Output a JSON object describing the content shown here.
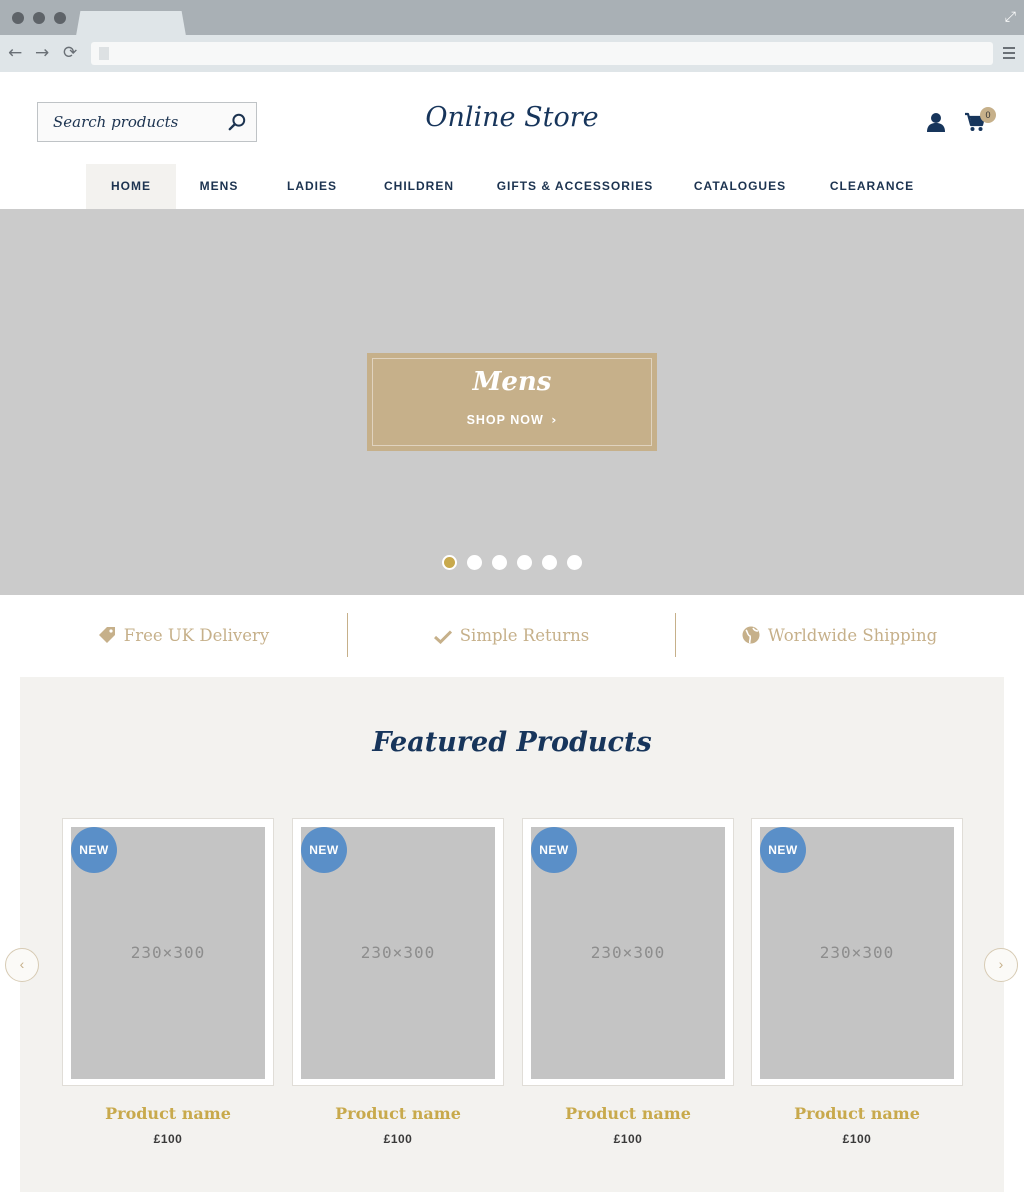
{
  "browser": {
    "window_controls": [
      "close-dot",
      "minimize-dot",
      "maximize-dot"
    ],
    "back_icon": "arrow-left-icon",
    "forward_icon": "arrow-right-icon",
    "reload_icon": "reload-icon",
    "menu_icon": "hamburger-menu-icon"
  },
  "header": {
    "search": {
      "placeholder": "Search products",
      "icon": "search-icon"
    },
    "logo": "Online Store",
    "account_icon": "user-icon",
    "cart": {
      "icon": "cart-icon",
      "count": "0"
    }
  },
  "nav": {
    "items": [
      {
        "label": "HOME",
        "active": true
      },
      {
        "label": "MENS"
      },
      {
        "label": "LADIES"
      },
      {
        "label": "CHILDREN"
      },
      {
        "label": "GIFTS & ACCESSORIES"
      },
      {
        "label": "CATALOGUES"
      },
      {
        "label": "CLEARANCE"
      }
    ]
  },
  "hero": {
    "title": "Mens",
    "cta": "SHOP NOW",
    "slide_count": 6,
    "active_slide": 1
  },
  "features": [
    {
      "label": "Free UK Delivery",
      "icon": "tag-icon"
    },
    {
      "label": "Simple Returns",
      "icon": "checkmark-icon"
    },
    {
      "label": "Worldwide Shipping",
      "icon": "globe-icon"
    }
  ],
  "featured": {
    "title": "Featured Products",
    "prev_icon": "chevron-left-icon",
    "next_icon": "chevron-right-icon",
    "products": [
      {
        "badge": "NEW",
        "image": "230×300",
        "name": "Product name",
        "price": "£100"
      },
      {
        "badge": "NEW",
        "image": "230×300",
        "name": "Product name",
        "price": "£100"
      },
      {
        "badge": "NEW",
        "image": "230×300",
        "name": "Product name",
        "price": "£100"
      },
      {
        "badge": "NEW",
        "image": "230×300",
        "name": "Product name",
        "price": "£100"
      }
    ]
  },
  "colors": {
    "navy": "#17355b",
    "gold": "#c6b08a",
    "gold_dark": "#c8a94c",
    "badge_blue": "#5a8fc8",
    "panel_bg": "#f3f2ef"
  }
}
